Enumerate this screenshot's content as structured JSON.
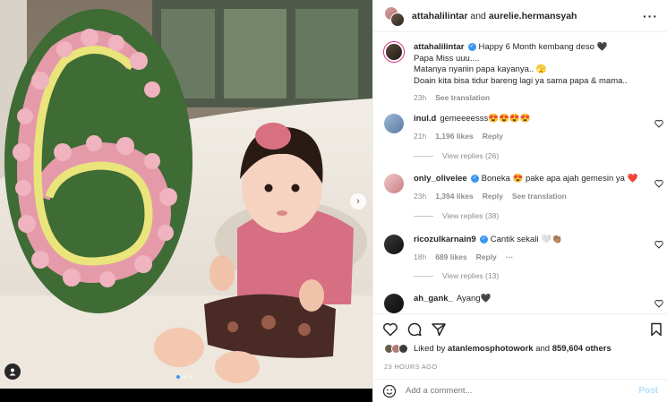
{
  "header": {
    "user1": "attahalilintar",
    "connector": "and",
    "user2": "aurelie.hermansyah"
  },
  "caption": {
    "username": "attahalilintar",
    "lines": [
      "Happy 6 Month kembang deso 🖤",
      "Papa Miss uuu....",
      "Matanya nyariin papa kayanya.. 🫣",
      "Doain kita bisa tidur bareng lagi ya sama papa & mama.."
    ],
    "time": "23h",
    "see_translation": "See translation"
  },
  "comments": [
    {
      "username": "inul.d",
      "text": "gemeeeesss😍😍😍😍",
      "time": "21h",
      "likes": "1,196 likes",
      "reply": "Reply",
      "view_replies": "View replies (26)"
    },
    {
      "username": "only_olivelee",
      "text": "Boneka 😍 pake apa ajah gemesin ya ❤️",
      "time": "23h",
      "likes": "1,394 likes",
      "reply": "Reply",
      "see_translation": "See translation",
      "view_replies": "View replies (38)"
    },
    {
      "username": "ricozulkarnain9",
      "text": "Cantik sekali 🤍👏🏽",
      "time": "18h",
      "likes": "689 likes",
      "reply": "Reply",
      "more": "···",
      "view_replies": "View replies (13)"
    },
    {
      "username": "ah_gank_",
      "text": "Ayang🖤"
    }
  ],
  "likes": {
    "prefix": "Liked by",
    "user": "atanlemosphotowork",
    "and": "and",
    "count": "859,604 others"
  },
  "date": "23 HOURS AGO",
  "composer": {
    "placeholder": "Add a comment...",
    "post_label": "Post"
  },
  "colors": {
    "accent": "#3897f0",
    "heart_red": "#ed4956",
    "muted": "#8e8e8e"
  },
  "media": {
    "dots_total": 3,
    "dots_active": 1
  }
}
